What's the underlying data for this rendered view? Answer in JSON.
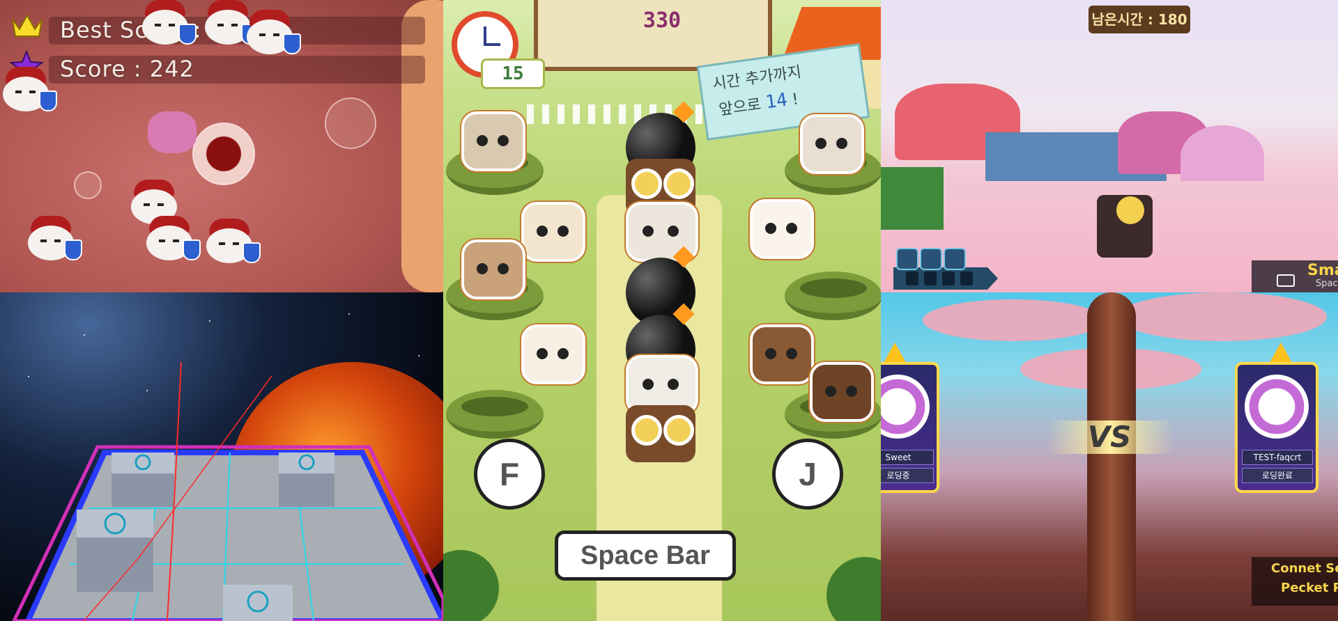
{
  "microbe_game": {
    "best_score_text": "Best Score : 74",
    "score_text": "Score : 242",
    "best_score_icon": "crown-icon",
    "score_icon": "star-icon"
  },
  "space_game": {
    "colors": {
      "grid": "#29d9e8",
      "frame_outer": "#d22fb9",
      "frame_inner": "#2a3bff"
    }
  },
  "pet_game": {
    "score": "330",
    "timer": "15",
    "bonus_line1": "시간 추가까지",
    "bonus_line2_prefix": "앞으로",
    "bonus_count": "14",
    "bonus_line2_suffix": "!",
    "left_key": "F",
    "right_key": "J",
    "space_label": "Space Bar"
  },
  "candy_game": {
    "time_label": "남은시간 : 180",
    "corner_title": "Sma",
    "corner_sub": "Space"
  },
  "vs_screen": {
    "vs_label": "VS",
    "left_player_name": "Sweet",
    "left_player_status": "로딩중",
    "right_player_name": "TEST-faqcrt",
    "right_player_status": "로딩완료",
    "toast_line1": "Connet Se",
    "toast_line2": "Pecket Pr"
  }
}
